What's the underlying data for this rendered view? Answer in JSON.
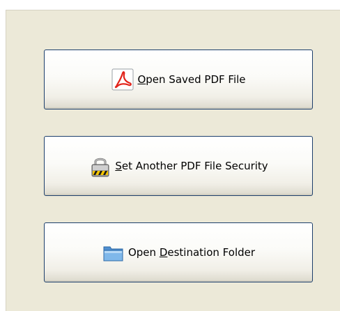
{
  "buttons": [
    {
      "mnemonic": "O",
      "rest": "pen Saved PDF File",
      "icon": "pdf-icon"
    },
    {
      "mnemonic": "S",
      "rest": "et Another PDF File Security",
      "icon": "lock-icon"
    },
    {
      "prefix": "Open ",
      "mnemonic": "D",
      "rest": "estination Folder",
      "icon": "folder-icon"
    }
  ],
  "colors": {
    "panel_background": "#ece9d8",
    "button_border": "#1c3e6b",
    "pdf_red": "#e2231a",
    "folder_blue": "#6aa8e2"
  }
}
